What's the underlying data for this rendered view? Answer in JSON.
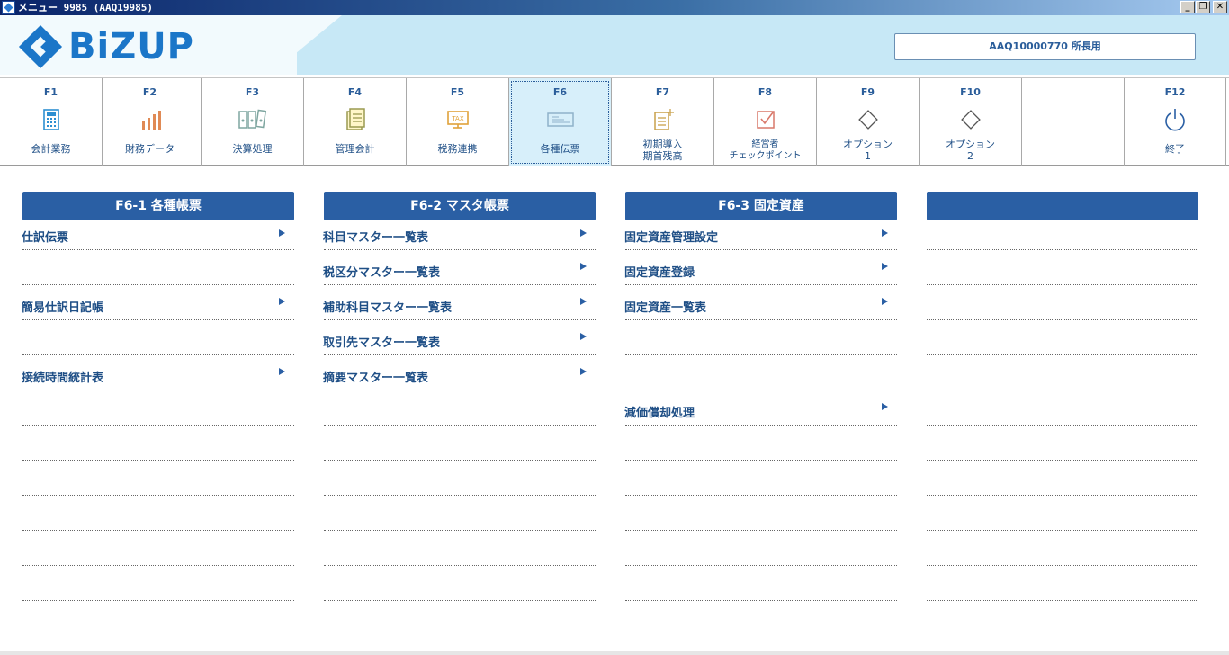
{
  "window": {
    "title": "メニュー 9985 (AAQ19985)",
    "controls": {
      "minimize": "_",
      "restore": "❐",
      "close": "✕"
    }
  },
  "header": {
    "logo_text": "BiZUP",
    "user_label": "AAQ10000770 所長用"
  },
  "fkeys": [
    {
      "code": "F1",
      "label": "会計業務",
      "icon": "calculator-icon"
    },
    {
      "code": "F2",
      "label": "財務データ",
      "icon": "bar-chart-icon"
    },
    {
      "code": "F3",
      "label": "決算処理",
      "icon": "binders-icon"
    },
    {
      "code": "F4",
      "label": "管理会計",
      "icon": "document-icon"
    },
    {
      "code": "F5",
      "label": "税務連携",
      "icon": "tax-monitor-icon"
    },
    {
      "code": "F6",
      "label": "各種伝票",
      "icon": "slip-icon"
    },
    {
      "code": "F7",
      "label": "初期導入",
      "label2": "期首残高",
      "icon": "document-add-icon"
    },
    {
      "code": "F8",
      "label": "経営者",
      "label2": "チェックポイント",
      "icon": "checkbox-icon"
    },
    {
      "code": "F9",
      "label": "オプション",
      "label2": "1",
      "icon": "diamond-icon"
    },
    {
      "code": "F10",
      "label": "オプション",
      "label2": "2",
      "icon": "diamond-icon"
    },
    {
      "code": "",
      "label": "",
      "icon": ""
    },
    {
      "code": "F12",
      "label": "終了",
      "icon": "power-icon"
    }
  ],
  "active_fkey": "F6",
  "panels": [
    {
      "title": "F6-1 各種帳票",
      "rows": [
        "仕訳伝票",
        "",
        "簡易仕訳日記帳",
        "",
        "接続時間統計表",
        "",
        "",
        "",
        "",
        "",
        ""
      ]
    },
    {
      "title": "F6-2 マスタ帳票",
      "rows": [
        "科目マスター一覧表",
        "税区分マスター一覧表",
        "補助科目マスター一覧表",
        "取引先マスター一覧表",
        "摘要マスター一覧表",
        "",
        "",
        "",
        "",
        "",
        ""
      ]
    },
    {
      "title": "F6-3 固定資産",
      "rows": [
        "固定資産管理設定",
        "固定資産登録",
        "固定資産一覧表",
        "",
        "",
        "減価償却処理",
        "",
        "",
        "",
        "",
        ""
      ]
    },
    {
      "title": "",
      "rows": [
        "",
        "",
        "",
        "",
        "",
        "",
        "",
        "",
        "",
        "",
        ""
      ]
    }
  ],
  "colors": {
    "accent": "#2a5fa4",
    "text": "#1f4f86",
    "banner": "#c7e8f6",
    "active_tab": "#d7effa"
  }
}
